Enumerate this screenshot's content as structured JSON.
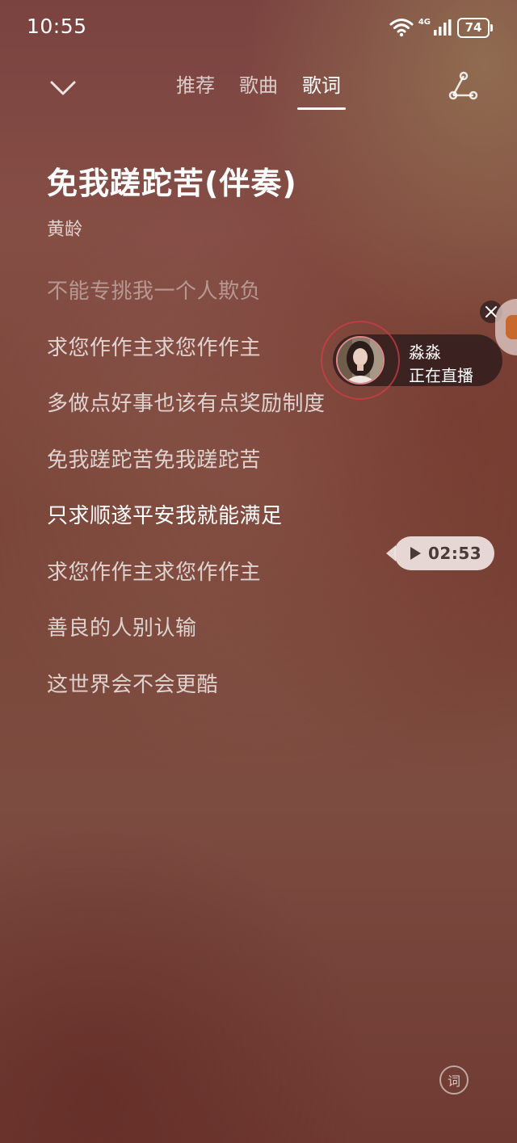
{
  "status_bar": {
    "time": "10:55",
    "network": "4G",
    "battery": "74"
  },
  "header": {
    "tabs": [
      {
        "label": "推荐",
        "active": false
      },
      {
        "label": "歌曲",
        "active": false
      },
      {
        "label": "歌词",
        "active": true
      }
    ],
    "left_icon": "chevron-down-icon",
    "right_icon": "share-icon"
  },
  "song": {
    "title": "免我蹉跎苦(伴奏)",
    "artist": "黄龄"
  },
  "lyrics": [
    "不能专挑我一个人欺负",
    "求您作作主求您作作主",
    "多做点好事也该有点奖励制度",
    "免我蹉跎苦免我蹉跎苦",
    "只求顺遂平安我就能满足",
    "求您作作主求您作作主",
    "善良的人别认输",
    "这世界会不会更酷"
  ],
  "current_lyric_index": 4,
  "live_popup": {
    "name": "淼淼",
    "status": "正在直播"
  },
  "seek_badge": {
    "time": "02:53"
  },
  "lyric_toggle_label": "词",
  "colors": {
    "background_top": "#7b4340",
    "background_bottom": "#6f3a32",
    "active_text": "#ffffff",
    "live_ring": "#d23c46"
  }
}
